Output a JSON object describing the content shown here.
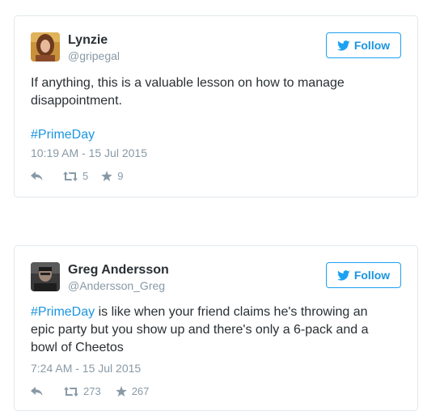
{
  "tweets": [
    {
      "author_name": "Lynzie",
      "author_handle": "@gripegal",
      "follow_label": "Follow",
      "text": "If anything, this is a valuable lesson on how to manage disappointment.",
      "hashtag": "#PrimeDay",
      "timestamp": "10:19 AM - 15 Jul 2015",
      "retweets": "5",
      "likes": "9"
    },
    {
      "author_name": "Greg Andersson",
      "author_handle": "@Andersson_Greg",
      "follow_label": "Follow",
      "hashtag": "#PrimeDay",
      "text": " is like when your friend claims he's throwing an epic party but you show up and there's only a 6-pack and a bowl of Cheetos",
      "timestamp": "7:24 AM - 15 Jul 2015",
      "retweets": "273",
      "likes": "267"
    }
  ],
  "icons": {
    "follow": "twitter-bird-icon",
    "reply": "reply-arrow-icon",
    "retweet": "retweet-icon",
    "like": "star-icon"
  },
  "colors": {
    "link_blue": "#1b95e0",
    "muted_gray": "#8899a6",
    "border": "#e1e8ed",
    "text": "#292f33"
  }
}
